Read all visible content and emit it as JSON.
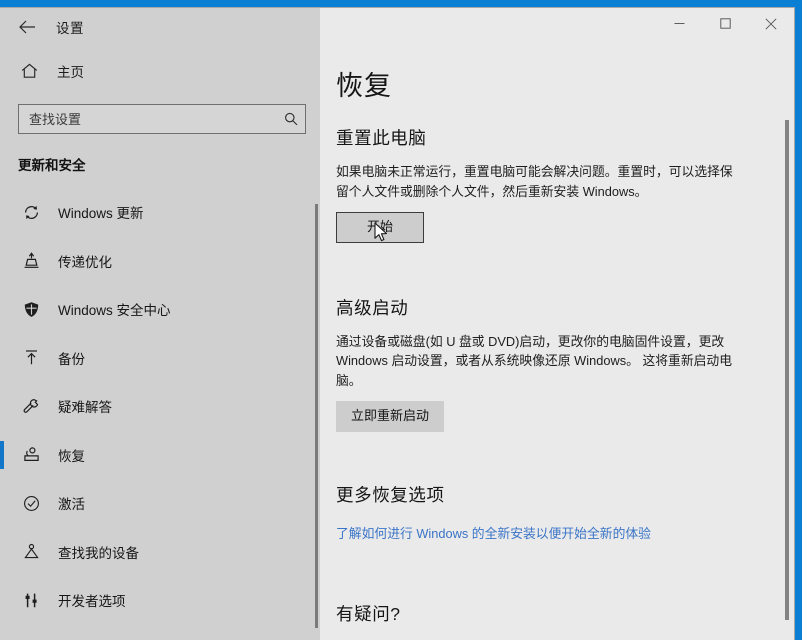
{
  "window": {
    "app_title": "设置",
    "back_label": "←",
    "controls": {
      "minimize": "minimize",
      "maximize": "maximize",
      "close": "close"
    }
  },
  "sidebar": {
    "home_label": "主页",
    "home_icon": "home-icon",
    "search": {
      "placeholder": "查找设置",
      "value": "",
      "icon": "search-icon"
    },
    "section_header": "更新和安全",
    "items": [
      {
        "label": "Windows 更新",
        "icon": "sync-icon",
        "selected": false
      },
      {
        "label": "传递优化",
        "icon": "delivery-icon",
        "selected": false
      },
      {
        "label": "Windows 安全中心",
        "icon": "shield-icon",
        "selected": false
      },
      {
        "label": "备份",
        "icon": "upload-icon",
        "selected": false
      },
      {
        "label": "疑难解答",
        "icon": "wrench-icon",
        "selected": false
      },
      {
        "label": "恢复",
        "icon": "recovery-icon",
        "selected": true
      },
      {
        "label": "激活",
        "icon": "check-circle-icon",
        "selected": false
      },
      {
        "label": "查找我的设备",
        "icon": "find-device-icon",
        "selected": false
      },
      {
        "label": "开发者选项",
        "icon": "dev-tools-icon",
        "selected": false
      }
    ]
  },
  "main": {
    "page_title": "恢复",
    "sections": {
      "reset": {
        "title": "重置此电脑",
        "body": "如果电脑未正常运行，重置电脑可能会解决问题。重置时，可以选择保留个人文件或删除个人文件，然后重新安装 Windows。",
        "button": "开始"
      },
      "advanced": {
        "title": "高级启动",
        "body": "通过设备或磁盘(如 U 盘或 DVD)启动，更改你的电脑固件设置，更改 Windows 启动设置，或者从系统映像还原 Windows。 这将重新启动电脑。",
        "button": "立即重新启动"
      },
      "more": {
        "title": "更多恢复选项",
        "link": "了解如何进行 Windows 的全新安装以便开始全新的体验"
      },
      "question": {
        "title": "有疑问?"
      }
    }
  },
  "colors": {
    "desktop_blue": "#0b7fd4",
    "accent_selection": "#1277c8",
    "link_blue": "#3a74c8",
    "nav_background": "#d0d0d0",
    "content_background": "#eaeaea",
    "button_gray": "#cdcdcd"
  }
}
